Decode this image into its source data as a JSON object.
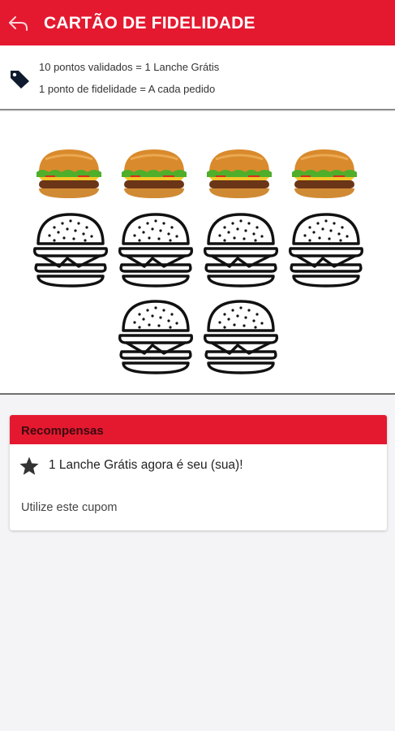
{
  "header": {
    "title": "CARTÃO DE FIDELIDADE",
    "back_icon": "reply-arrow-icon",
    "background": "#e4192f"
  },
  "info": {
    "icon": "tag-icon",
    "line1": "10 pontos validados = 1 Lanche Grátis",
    "line2": "1 ponto de fidelidade = A cada pedido"
  },
  "stamps": {
    "total": 10,
    "filled": 4,
    "filled_icon": "burger-photo-icon",
    "empty_icon": "burger-outline-icon"
  },
  "rewards": {
    "title": "Recompensas",
    "item_icon": "star-icon",
    "item_text": "1 Lanche Grátis agora é seu (sua)!",
    "coupon_link": "Utilize este cupom"
  }
}
